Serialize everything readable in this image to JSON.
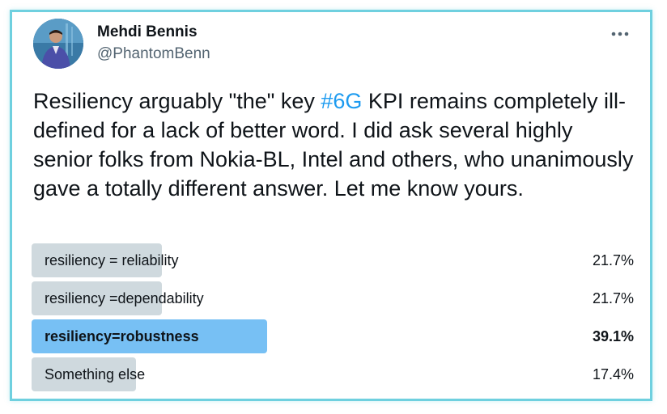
{
  "author": {
    "name": "Mehdi Bennis",
    "handle": "@PhantomBenn"
  },
  "icons": {
    "more": "more-horizontal-icon"
  },
  "tweet": {
    "text_before": "Resiliency  arguably \"the\" key ",
    "hashtag": "#6G",
    "text_after": " KPI remains completely ill-defined for a lack of better word. I did ask several highly senior folks from Nokia-BL, Intel and others, who unanimously gave a totally different answer. Let me know yours."
  },
  "poll": {
    "options": [
      {
        "label": "resiliency = reliability",
        "percent_label": "21.7%",
        "percent": 21.7,
        "winner": false
      },
      {
        "label": "resiliency =dependability",
        "percent_label": "21.7%",
        "percent": 21.7,
        "winner": false
      },
      {
        "label": "resiliency=robustness",
        "percent_label": "39.1%",
        "percent": 39.1,
        "winner": true
      },
      {
        "label": "Something else",
        "percent_label": "17.4%",
        "percent": 17.4,
        "winner": false
      }
    ]
  },
  "colors": {
    "border": "#6fd0df",
    "hashtag": "#1d9bf0",
    "bar": "#cfd9de",
    "winner_bar": "#77c0f4"
  }
}
